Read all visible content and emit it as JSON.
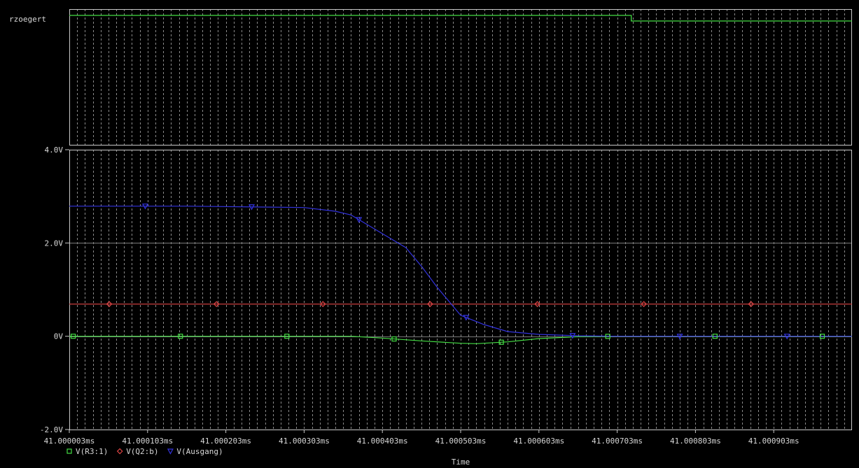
{
  "window": {
    "title": "",
    "digital_panel_label": "rzoegert",
    "x_axis_title": "Time"
  },
  "colors": {
    "background": "#000000",
    "frame": "#c8c8c8",
    "grid_dashed": "#8a8a8a",
    "grid_hline": "#7a7a7a",
    "text": "#d8d8d8",
    "digital_trace": "#44dd44"
  },
  "chart_data": [
    {
      "type": "line",
      "title": "",
      "panel": "digital",
      "series": [
        {
          "name": "rzoegert",
          "color": "#44dd44",
          "marker": "none",
          "points": [
            [
              41.000003,
              1
            ],
            [
              41.000721,
              1
            ],
            [
              41.000721,
              0
            ],
            [
              41.001003,
              0
            ]
          ]
        }
      ]
    },
    {
      "type": "line",
      "title": "",
      "panel": "analog",
      "xlabel": "Time",
      "ylabel": "",
      "xlim": [
        41.000003,
        41.001003
      ],
      "ylim": [
        -2.0,
        4.0
      ],
      "grid": true,
      "legend": "bottom-left",
      "y_ticks": [
        {
          "value": 4.0,
          "label": "4.0V"
        },
        {
          "value": 2.0,
          "label": "2.0V"
        },
        {
          "value": 0.0,
          "label": "0V"
        },
        {
          "value": -2.0,
          "label": "-2.0V"
        }
      ],
      "x_ticks": [
        {
          "value": 41.000003,
          "label": "41.000003ms"
        },
        {
          "value": 41.000103,
          "label": "41.000103ms"
        },
        {
          "value": 41.000203,
          "label": "41.000203ms"
        },
        {
          "value": 41.000303,
          "label": "41.000303ms"
        },
        {
          "value": 41.000403,
          "label": "41.000403ms"
        },
        {
          "value": 41.000503,
          "label": "41.000503ms"
        },
        {
          "value": 41.000603,
          "label": "41.000603ms"
        },
        {
          "value": 41.000703,
          "label": "41.000703ms"
        },
        {
          "value": 41.000803,
          "label": "41.000803ms"
        },
        {
          "value": 41.000903,
          "label": "41.000903ms"
        }
      ],
      "series": [
        {
          "name": "V(R3:1)",
          "color": "#44dd44",
          "marker": "square",
          "points": [
            [
              41.000003,
              0.0
            ],
            [
              41.000363,
              0.0
            ],
            [
              41.000403,
              -0.04
            ],
            [
              41.000453,
              -0.1
            ],
            [
              41.000503,
              -0.15
            ],
            [
              41.000523,
              -0.16
            ],
            [
              41.000563,
              -0.12
            ],
            [
              41.000603,
              -0.05
            ],
            [
              41.000653,
              -0.01
            ],
            [
              41.000703,
              0.0
            ],
            [
              41.001003,
              0.0
            ]
          ],
          "marker_x": [
            41.000008,
            41.000145,
            41.000281,
            41.000418,
            41.000555,
            41.000691,
            41.000828,
            41.000965
          ]
        },
        {
          "name": "V(Q2:b)",
          "color": "#dd4444",
          "marker": "diamond",
          "points": [
            [
              41.000003,
              0.69
            ],
            [
              41.001003,
              0.69
            ]
          ],
          "marker_x": [
            41.000054,
            41.000191,
            41.000327,
            41.000464,
            41.000601,
            41.000737,
            41.000874
          ]
        },
        {
          "name": "V(Ausgang)",
          "color": "#3333dd",
          "marker": "triangle-down",
          "points": [
            [
              41.000003,
              2.79
            ],
            [
              41.000153,
              2.79
            ],
            [
              41.000253,
              2.77
            ],
            [
              41.000303,
              2.76
            ],
            [
              41.000343,
              2.68
            ],
            [
              41.000363,
              2.6
            ],
            [
              41.000403,
              2.2
            ],
            [
              41.000433,
              1.9
            ],
            [
              41.000453,
              1.5
            ],
            [
              41.000473,
              1.05
            ],
            [
              41.000503,
              0.45
            ],
            [
              41.000533,
              0.25
            ],
            [
              41.000563,
              0.1
            ],
            [
              41.000603,
              0.04
            ],
            [
              41.000653,
              0.01
            ],
            [
              41.000703,
              0.0
            ],
            [
              41.001003,
              0.0
            ]
          ],
          "marker_x": [
            41.0001,
            41.000236,
            41.000373,
            41.00051,
            41.000646,
            41.000783,
            41.00092
          ]
        }
      ]
    }
  ]
}
